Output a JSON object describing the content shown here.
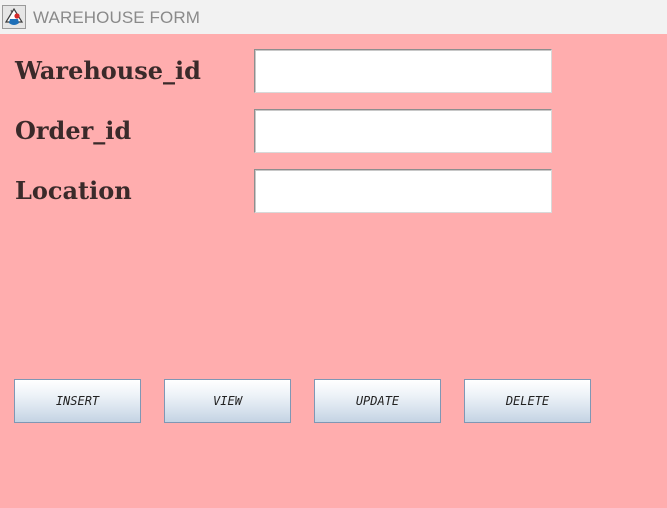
{
  "window": {
    "title": "WAREHOUSE FORM",
    "app_icon": "java-coffee-cup-icon"
  },
  "form": {
    "fields": [
      {
        "label": "Warehouse_id",
        "value": ""
      },
      {
        "label": "Order_id",
        "value": ""
      },
      {
        "label": "Location",
        "value": ""
      }
    ]
  },
  "buttons": {
    "insert": "INSERT",
    "view": "VIEW",
    "update": "UPDATE",
    "delete": "DELETE"
  },
  "colors": {
    "background": "#ffadae",
    "titlebar": "#f2f2f2",
    "label_text": "#3a2a2a"
  }
}
